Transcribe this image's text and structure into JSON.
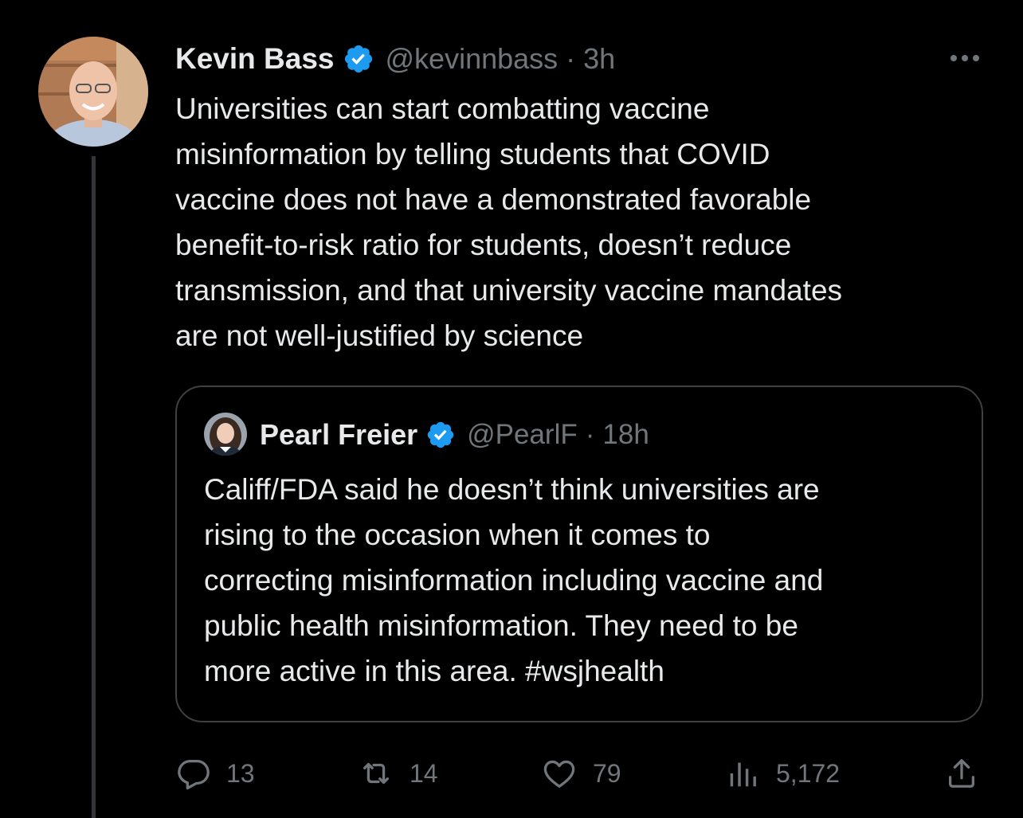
{
  "tweet": {
    "author_name": "Kevin Bass",
    "author_handle": "@kevinnbass",
    "separator": "·",
    "time": "3h",
    "text": "Universities can start combatting vaccine\nmisinformation by telling students that COVID\nvaccine does not have a demonstrated favorable\nbenefit-to-risk ratio for students, doesn’t reduce\ntransmission, and that university vaccine mandates\nare not well-justified by science"
  },
  "quoted_tweet": {
    "author_name": "Pearl Freier",
    "author_handle": "@PearlF",
    "separator": "·",
    "time": "18h",
    "text": "Califf/FDA said he doesn’t think universities are\nrising to the occasion when it comes to\ncorrecting misinformation including vaccine and\npublic health misinformation. They need to be\nmore active in this area. #wsjhealth"
  },
  "actions": {
    "replies": "13",
    "reposts": "14",
    "likes": "79",
    "views": "5,172"
  },
  "icons": {
    "verified": "verified-badge-icon",
    "more": "more-options-icon",
    "reply": "reply-icon",
    "repost": "repost-icon",
    "like": "heart-icon",
    "views": "views-chart-icon",
    "share": "share-icon"
  },
  "colors": {
    "background": "#000000",
    "text_primary": "#e7e9ea",
    "text_secondary": "#71767b",
    "verified_blue": "#1d9bf0",
    "border": "#3e4144"
  }
}
